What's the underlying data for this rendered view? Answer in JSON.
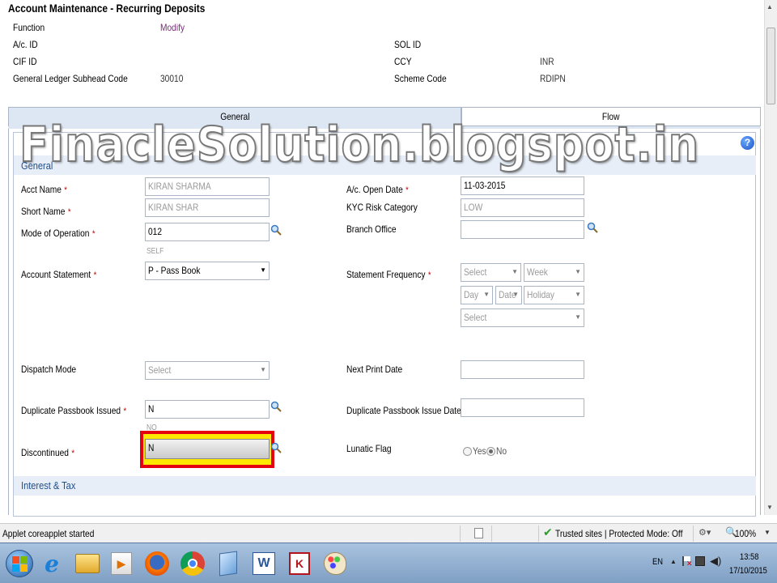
{
  "page": {
    "title": "Account Maintenance - Recurring Deposits"
  },
  "header": {
    "function_label": "Function",
    "function_value": "Modify",
    "acid_label": "A/c. ID",
    "sol_label": "SOL ID",
    "cif_label": "CIF ID",
    "ccy_label": "CCY",
    "ccy_value": "INR",
    "gl_label": "General Ledger Subhead Code",
    "gl_value": "30010",
    "scheme_label": "Scheme Code",
    "scheme_value": "RDIPN"
  },
  "tabs": [
    {
      "label": "General"
    },
    {
      "label": "Flow"
    }
  ],
  "watermark": "FinacleSolution.blogspot.in",
  "help_icon_text": "?",
  "section": {
    "general": "General",
    "interest": "Interest & Tax"
  },
  "required_mark": "*",
  "form": {
    "acct_name_label": "Acct Name",
    "acct_name_value": "KIRAN SHARMA",
    "open_date_label": "A/c. Open Date",
    "open_date_value": "11-03-2015",
    "short_name_label": "Short Name",
    "short_name_value": "KIRAN SHAR",
    "kyc_label": "KYC Risk Category",
    "kyc_value": "LOW",
    "mode_label": "Mode of Operation",
    "mode_value": "012",
    "mode_desc": "SELF",
    "branch_label": "Branch Office",
    "branch_value": "",
    "stmt_label": "Account Statement",
    "stmt_value": "P - Pass Book",
    "freq_label": "Statement Frequency",
    "freq_select1": "Select",
    "freq_week": "Week",
    "freq_day": "Day",
    "freq_date": "Date",
    "freq_holiday": "Holiday",
    "freq_select2": "Select",
    "dispatch_label": "Dispatch Mode",
    "dispatch_value": "Select",
    "next_print_label": "Next Print Date",
    "next_print_value": "",
    "dup_label": "Duplicate Passbook Issued",
    "dup_value": "N",
    "dup_desc": "NO",
    "dup_date_label": "Duplicate Passbook Issue Date",
    "dup_date_value": "",
    "disc_label": "Discontinued",
    "disc_value": "N",
    "lunatic_label": "Lunatic Flag",
    "lunatic_yes": "Yes",
    "lunatic_no": "No"
  },
  "status": {
    "text": "Applet coreapplet started",
    "zone": "Trusted sites | Protected Mode: Off",
    "zoom": "100%"
  },
  "tray": {
    "lang": "EN",
    "time": "13:58",
    "date": "17/10/2015"
  },
  "colors": {
    "tab_active": "#dde6f3",
    "section_bg": "#e7eef8",
    "highlight_red": "#e3000f",
    "highlight_yellow": "#ffe800",
    "section_text": "#1f4e8c"
  }
}
